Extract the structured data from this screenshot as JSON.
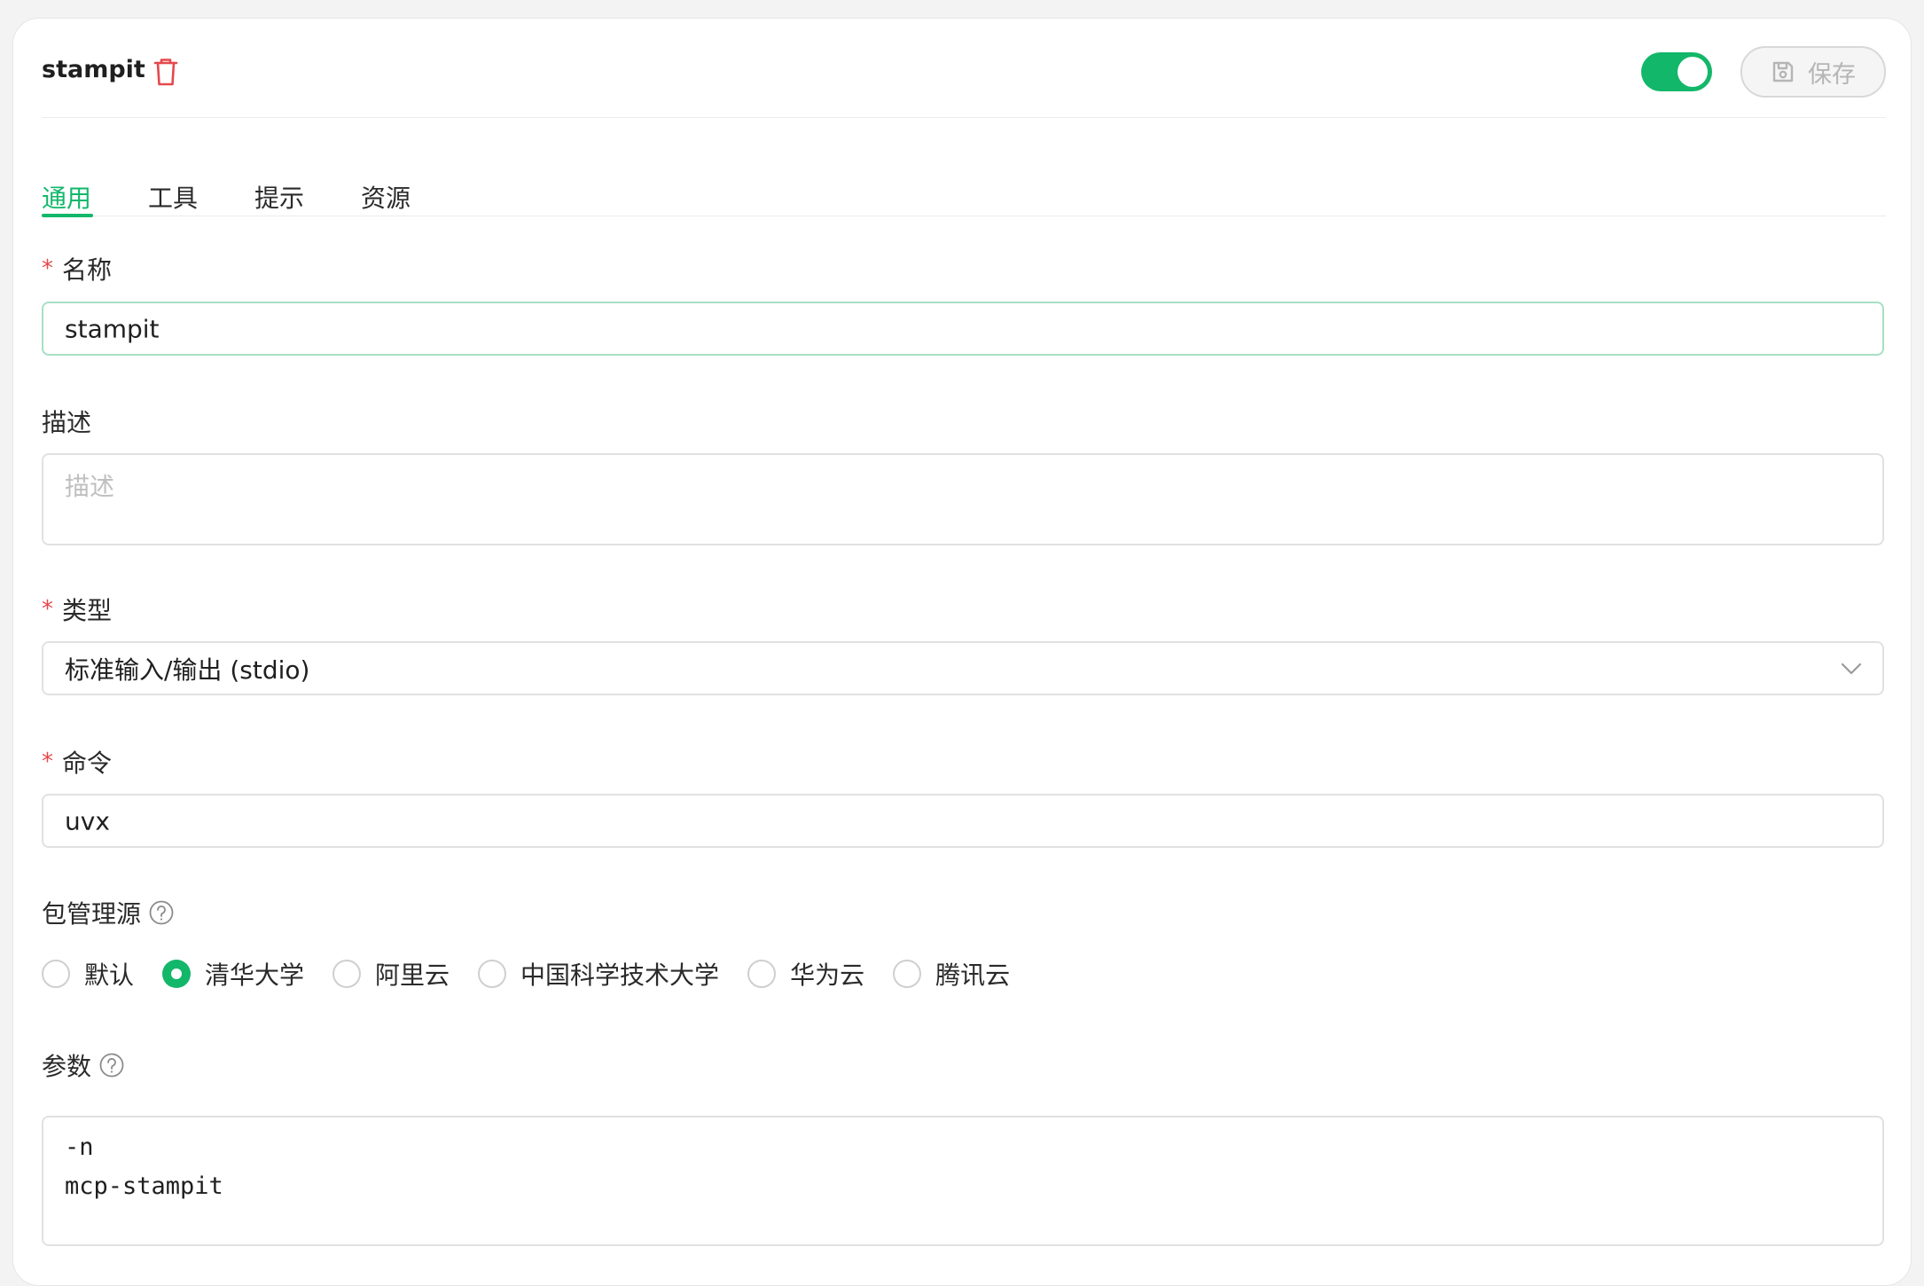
{
  "header": {
    "server_name": "stampit",
    "enabled": true,
    "save_label": "保存"
  },
  "tabs": [
    {
      "label": "通用",
      "active": true
    },
    {
      "label": "工具",
      "active": false
    },
    {
      "label": "提示",
      "active": false
    },
    {
      "label": "资源",
      "active": false
    }
  ],
  "form": {
    "name": {
      "label": "名称",
      "required_mark": "*",
      "value": "stampit"
    },
    "description": {
      "label": "描述",
      "placeholder": "描述",
      "value": ""
    },
    "type": {
      "label": "类型",
      "required_mark": "*",
      "value": "标准输入/输出 (stdio)"
    },
    "command": {
      "label": "命令",
      "required_mark": "*",
      "value": "uvx"
    },
    "registry": {
      "label": "包管理源",
      "options": [
        "默认",
        "清华大学",
        "阿里云",
        "中国科学技术大学",
        "华为云",
        "腾讯云"
      ],
      "selected": "清华大学"
    },
    "args": {
      "label": "参数",
      "lines": [
        "-n",
        "mcp-stampit"
      ]
    }
  },
  "colors": {
    "accent": "#12b76a",
    "required": "#e5484d",
    "delete": "#e5484d"
  }
}
